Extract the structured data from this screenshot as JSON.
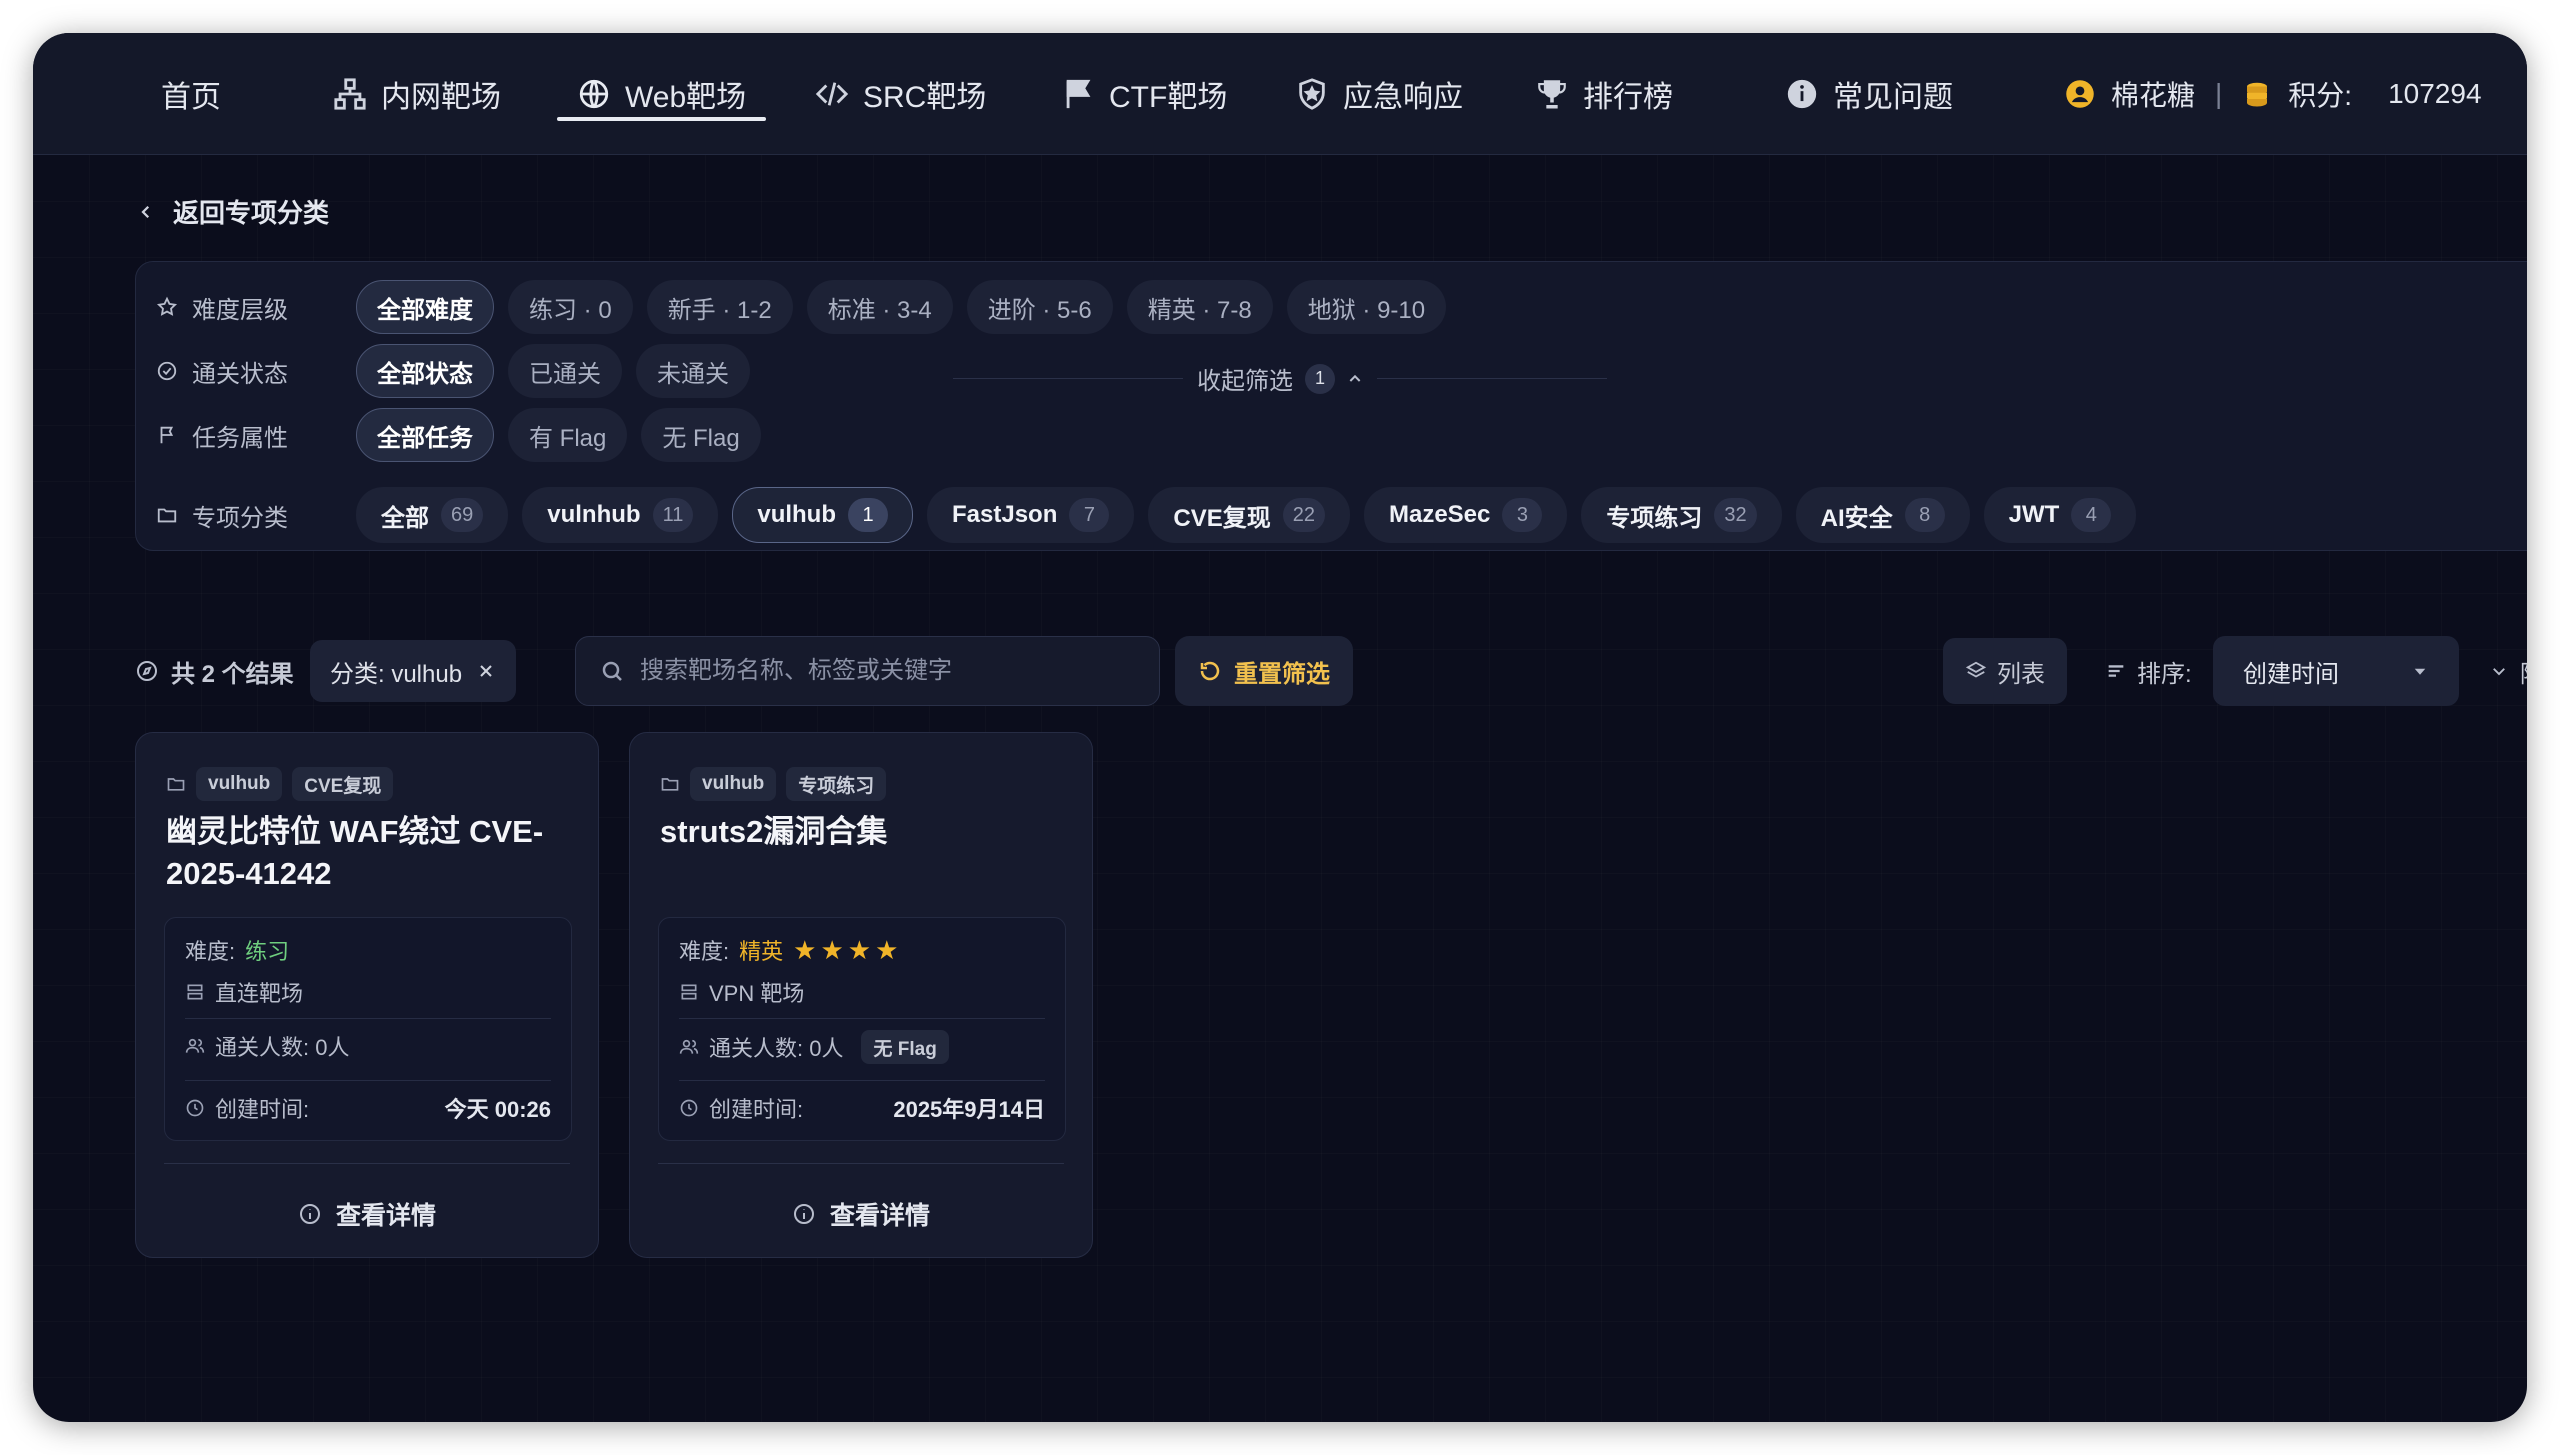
{
  "nav": {
    "items": [
      {
        "label": "首页",
        "icon": "none"
      },
      {
        "label": "内网靶场",
        "icon": "network-icon"
      },
      {
        "label": "Web靶场",
        "icon": "globe-icon",
        "active": true
      },
      {
        "label": "SRC靶场",
        "icon": "code-icon"
      },
      {
        "label": "CTF靶场",
        "icon": "flag-icon"
      },
      {
        "label": "应急响应",
        "icon": "shield-icon"
      },
      {
        "label": "排行榜",
        "icon": "trophy-icon"
      },
      {
        "label": "常见问题",
        "icon": "info-icon"
      }
    ],
    "username": "棉花糖",
    "separator": "|",
    "points_label": "积分:",
    "points_value": "107294"
  },
  "back_label": "返回专项分类",
  "filters": {
    "difficulty": {
      "label": "难度层级",
      "options": [
        "全部难度",
        "练习 · 0",
        "新手 · 1-2",
        "标准 · 3-4",
        "进阶 · 5-6",
        "精英 · 7-8",
        "地狱 · 9-10"
      ],
      "selected": 0
    },
    "status": {
      "label": "通关状态",
      "options": [
        "全部状态",
        "已通关",
        "未通关"
      ],
      "selected": 0
    },
    "task": {
      "label": "任务属性",
      "options": [
        "全部任务",
        "有 Flag",
        "无 Flag"
      ],
      "selected": 0
    },
    "category": {
      "label": "专项分类",
      "options": [
        {
          "name": "全部",
          "count": "69"
        },
        {
          "name": "vulnhub",
          "count": "11"
        },
        {
          "name": "vulhub",
          "count": "1"
        },
        {
          "name": "FastJson",
          "count": "7"
        },
        {
          "name": "CVE复现",
          "count": "22"
        },
        {
          "name": "MazeSec",
          "count": "3"
        },
        {
          "name": "专项练习",
          "count": "32"
        },
        {
          "name": "AI安全",
          "count": "8"
        },
        {
          "name": "JWT",
          "count": "4"
        }
      ],
      "selected": 2
    },
    "collapse_label": "收起筛选",
    "collapse_count": "1"
  },
  "toolbar": {
    "result_count": "共 2 个结果",
    "active_tag": "分类: vulhub",
    "search_placeholder": "搜索靶场名称、标签或关键字",
    "reset_label": "重置筛选",
    "view_label": "列表",
    "sort_label": "排序:",
    "sort_value": "创建时间",
    "order_label": "降序"
  },
  "cards": [
    {
      "tags": [
        "vulhub",
        "CVE复现"
      ],
      "title": "幽灵比特位 WAF绕过 CVE-2025-41242",
      "difficulty_label": "难度:",
      "difficulty_value": "练习",
      "difficulty_color": "#6fcf7f",
      "stars": "",
      "type": "直连靶场",
      "passers": "通关人数: 0人",
      "flag_badge": "",
      "created_label": "创建时间:",
      "created_value": "今天 00:26",
      "detail_label": "查看详情"
    },
    {
      "tags": [
        "vulhub",
        "专项练习"
      ],
      "title": "struts2漏洞合集",
      "difficulty_label": "难度:",
      "difficulty_value": "精英",
      "difficulty_color": "#f0b429",
      "stars": "★★★★",
      "type": "VPN 靶场",
      "passers": "通关人数: 0人",
      "flag_badge": "无 Flag",
      "created_label": "创建时间:",
      "created_value": "2025年9月14日",
      "detail_label": "查看详情"
    }
  ]
}
